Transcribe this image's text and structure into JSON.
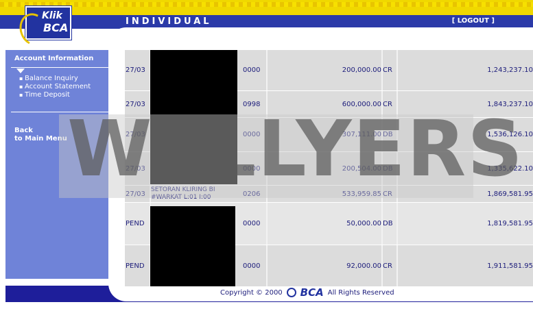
{
  "header": {
    "logo_line1": "Klik",
    "logo_line2": "BCA",
    "section_title": "INDIVIDUAL",
    "logout_label": "[ LOGOUT ]"
  },
  "sidebar": {
    "title": "Account Information",
    "items": [
      "Balance Inquiry",
      "Account Statement",
      "Time Deposit"
    ],
    "back_line1": "Back",
    "back_line2": "to Main Menu"
  },
  "transactions": [
    {
      "date": "27/03",
      "description": "",
      "branch": "0000",
      "amount": "200,000.00",
      "type": "CR",
      "balance": "1,243,237.10"
    },
    {
      "date": "27/03",
      "description": "",
      "branch": "0998",
      "amount": "600,000.00",
      "type": "CR",
      "balance": "1,843,237.10"
    },
    {
      "date": "27/03",
      "description": "",
      "branch": "0000",
      "amount": "307,111.00",
      "type": "DB",
      "balance": "1,536,126.10"
    },
    {
      "date": "27/03",
      "description": "",
      "branch": "0000",
      "amount": "200,504.00",
      "type": "DB",
      "balance": "1,335,622.10"
    },
    {
      "date": "27/03",
      "description": "SETORAN KLIRING BI #WARKAT L:01 I:00",
      "branch": "0206",
      "amount": "533,959.85",
      "type": "CR",
      "balance": "1,869,581.95"
    },
    {
      "date": "PEND",
      "description": "",
      "branch": "0000",
      "amount": "50,000.00",
      "type": "DB",
      "balance": "1,819,581.95"
    },
    {
      "date": "PEND",
      "description": "",
      "branch": "0000",
      "amount": "92,000.00",
      "type": "CR",
      "balance": "1,911,581.95"
    }
  ],
  "watermark": "WELLYERS",
  "footer": {
    "copyright": "Copyright © 2000",
    "brand": "BCA",
    "rights": "All Rights Reserved"
  },
  "colors": {
    "brand_blue": "#2b3aa8",
    "sidebar_blue": "#6f83d8",
    "accent_yellow": "#f0d800",
    "row_gray": "#dcdcdc"
  }
}
